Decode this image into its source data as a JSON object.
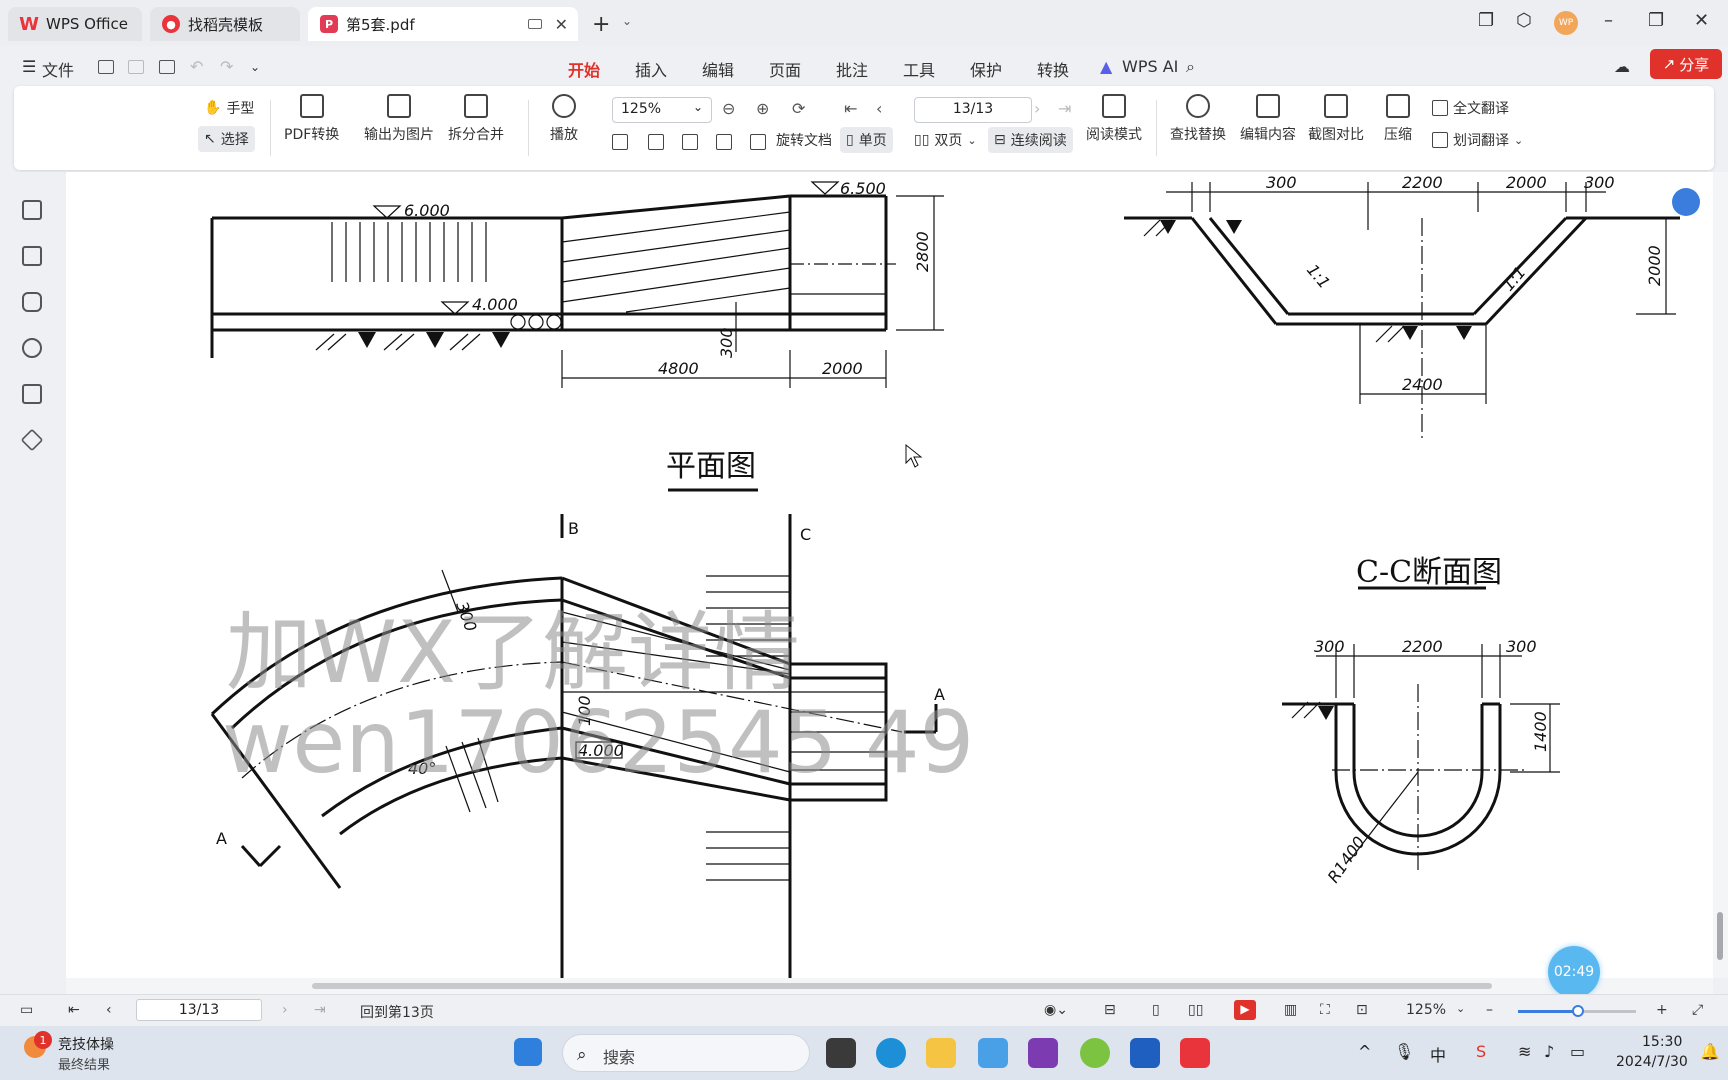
{
  "titlebar": {
    "tabs": [
      {
        "label": "WPS Office"
      },
      {
        "label": "找稻壳模板"
      },
      {
        "label": "第5套.pdf"
      }
    ]
  },
  "menubar": {
    "file": "文件",
    "items": [
      "开始",
      "插入",
      "编辑",
      "页面",
      "批注",
      "工具",
      "保护",
      "转换",
      "WPS AI"
    ],
    "active": "开始",
    "share": "分享"
  },
  "toolbar": {
    "hand": "手型",
    "select": "选择",
    "pdf_convert": "PDF转换",
    "export_image": "输出为图片",
    "split_merge": "拆分合并",
    "play": "播放",
    "zoom": "125%",
    "page": "13/13",
    "rotate": "旋转文档",
    "single": "单页",
    "double": "双页",
    "continuous": "连续阅读",
    "reading_mode": "阅读模式",
    "find_replace": "查找替换",
    "edit_content": "编辑内容",
    "screenshot_compare": "截图对比",
    "compress": "压缩",
    "full_translate": "全文翻译",
    "word_translate": "划词翻译"
  },
  "document": {
    "top_dims": {
      "elev_6000": "6.000",
      "elev_6500": "6.500",
      "elev_4000": "4.000",
      "d2800": "2800",
      "d300": "300",
      "d4800": "4800",
      "d2000": "2000"
    },
    "section_dims": {
      "d300a": "300",
      "d2200": "2200",
      "d2000": "2000",
      "d300b": "300",
      "slope1": "1:1",
      "slope2": "1:1",
      "h2000": "2000",
      "d2400": "2400"
    },
    "plan_title": "平面图",
    "plan_labels": {
      "b": "B",
      "c": "C",
      "a1": "A",
      "a2": "A",
      "d300": "300",
      "d100": "100",
      "elev": "4.000",
      "angle": "40°"
    },
    "cc_title": "C-C断面图",
    "cc_dims": {
      "d300a": "300",
      "d2200": "2200",
      "d300b": "300",
      "h1400": "1400",
      "r1400": "R1400"
    },
    "watermark_line1": "加WX了解详情",
    "watermark_line2": "wen17062545 49"
  },
  "statusbar": {
    "page": "13/13",
    "back_label": "回到第13页",
    "zoom": "125%"
  },
  "timer": "02:49",
  "taskbar": {
    "notif_count": "1",
    "notif_title": "竞技体操",
    "notif_sub": "最终结果",
    "search": "搜索",
    "ime": "中",
    "time": "15:30",
    "date": "2024/7/30"
  }
}
